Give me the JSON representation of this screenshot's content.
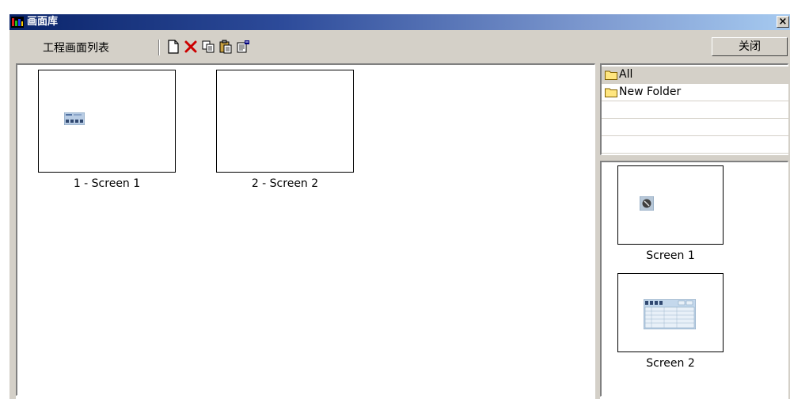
{
  "window": {
    "title": "画面库",
    "close_glyph": "×"
  },
  "toolbar": {
    "title": "工程画面列表",
    "icons": [
      "new-document-icon",
      "delete-icon",
      "copy-icon",
      "paste-icon",
      "properties-icon"
    ],
    "close_button": "关闭"
  },
  "project_screens": [
    {
      "label": "1 - Screen 1"
    },
    {
      "label": "2 - Screen 2"
    }
  ],
  "folders": [
    {
      "label": "All",
      "selected": true
    },
    {
      "label": "New Folder",
      "selected": false
    }
  ],
  "library_screens": [
    {
      "label": "Screen 1"
    },
    {
      "label": "Screen 2"
    }
  ],
  "colors": {
    "title_start": "#0a246a",
    "title_end": "#a6caf0",
    "face": "#d4d0c8",
    "delete_red": "#cc0000",
    "folder_yellow": "#ffe680"
  }
}
